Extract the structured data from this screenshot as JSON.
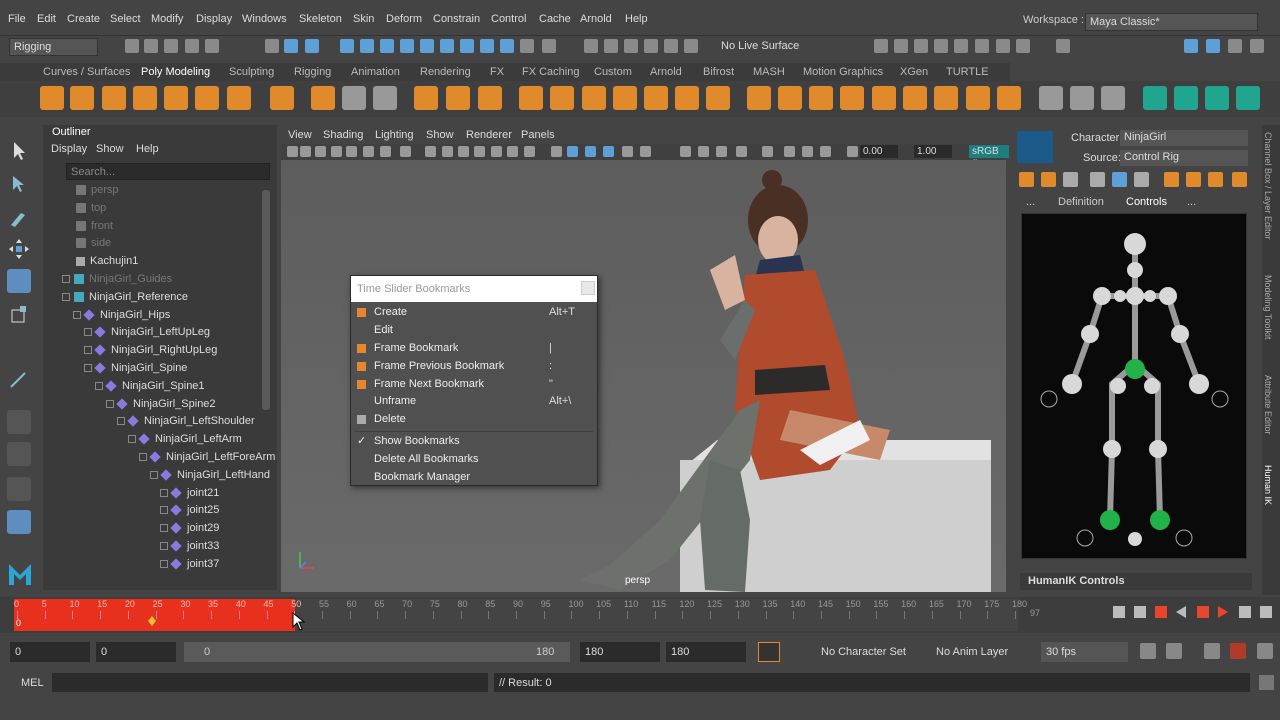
{
  "menubar": {
    "items": [
      "File",
      "Edit",
      "Create",
      "Select",
      "Modify",
      "Display",
      "Windows",
      "Skeleton",
      "Skin",
      "Deform",
      "Constrain",
      "Control",
      "Cache",
      "Arnold",
      "Help"
    ],
    "workspace_label": "Workspace :",
    "workspace_value": "Maya Classic*"
  },
  "statusline": {
    "menuset": "Rigging",
    "live_surface": "No Live Surface"
  },
  "shelf": {
    "tabs": [
      "Curves / Surfaces",
      "Poly Modeling",
      "Sculpting",
      "Rigging",
      "Animation",
      "Rendering",
      "FX",
      "FX Caching",
      "Custom",
      "Arnold",
      "Bifrost",
      "MASH",
      "Motion Graphics",
      "XGen",
      "TURTLE"
    ],
    "active_tab": "Poly Modeling"
  },
  "outliner": {
    "title": "Outliner",
    "menu": [
      "Display",
      "Show",
      "Help"
    ],
    "search_placeholder": "Search...",
    "rows": [
      {
        "label": "persp",
        "dim": true
      },
      {
        "label": "top",
        "dim": true
      },
      {
        "label": "front",
        "dim": true
      },
      {
        "label": "side",
        "dim": true
      },
      {
        "label": "Kachujin1",
        "dim": false
      },
      {
        "label": "NinjaGirl_Guides",
        "dim": true
      },
      {
        "label": "NinjaGirl_Reference",
        "dim": false
      },
      {
        "label": "NinjaGirl_Hips",
        "dim": false
      },
      {
        "label": "NinjaGirl_LeftUpLeg",
        "dim": false
      },
      {
        "label": "NinjaGirl_RightUpLeg",
        "dim": false
      },
      {
        "label": "NinjaGirl_Spine",
        "dim": false
      },
      {
        "label": "NinjaGirl_Spine1",
        "dim": false
      },
      {
        "label": "NinjaGirl_Spine2",
        "dim": false
      },
      {
        "label": "NinjaGirl_LeftShoulder",
        "dim": false
      },
      {
        "label": "NinjaGirl_LeftArm",
        "dim": false
      },
      {
        "label": "NinjaGirl_LeftForeArm",
        "dim": false
      },
      {
        "label": "NinjaGirl_LeftHand",
        "dim": false
      },
      {
        "label": "joint21",
        "dim": false
      },
      {
        "label": "joint25",
        "dim": false
      },
      {
        "label": "joint29",
        "dim": false
      },
      {
        "label": "joint33",
        "dim": false
      },
      {
        "label": "joint37",
        "dim": false
      }
    ]
  },
  "viewport": {
    "menu": [
      "View",
      "Shading",
      "Lighting",
      "Show",
      "Renderer",
      "Panels"
    ],
    "value1": "0.00",
    "value2": "1.00",
    "colorspace": "sRGB g",
    "camera_label": "persp"
  },
  "context_menu": {
    "title": "Time Slider Bookmarks",
    "items": [
      {
        "label": "Create",
        "shortcut": "Alt+T"
      },
      {
        "label": "Edit",
        "shortcut": ""
      },
      {
        "label": "Frame Bookmark",
        "shortcut": "|"
      },
      {
        "label": "Frame Previous Bookmark",
        "shortcut": ":"
      },
      {
        "label": "Frame Next Bookmark",
        "shortcut": "\""
      },
      {
        "label": "Unframe",
        "shortcut": "Alt+\\"
      },
      {
        "label": "Delete",
        "shortcut": ""
      },
      {
        "label": "Show Bookmarks",
        "shortcut": ""
      },
      {
        "label": "Delete All Bookmarks",
        "shortcut": ""
      },
      {
        "label": "Bookmark Manager",
        "shortcut": ""
      }
    ]
  },
  "humanik": {
    "character_label": "Character:",
    "character_value": "NinjaGirl",
    "source_label": "Source:",
    "source_value": "Control Rig",
    "tabs": [
      "...",
      "Definition",
      "Controls",
      "..."
    ],
    "active_tab": "Controls",
    "controls_header": "HumanIK Controls"
  },
  "side_tabs": [
    "Channel Box / Layer Editor",
    "Modeling Toolkit",
    "Attribute Editor",
    "Human IK"
  ],
  "timeline": {
    "ticks": [
      "0",
      "5",
      "10",
      "15",
      "20",
      "25",
      "30",
      "35",
      "40",
      "45",
      "50",
      "55",
      "60",
      "65",
      "70",
      "75",
      "80",
      "85",
      "90",
      "95",
      "100",
      "105",
      "110",
      "115",
      "120",
      "125",
      "130",
      "135",
      "140",
      "145",
      "150",
      "155",
      "160",
      "165",
      "170",
      "175",
      "180"
    ],
    "current_frame": "0",
    "end_field": "97",
    "red_color": "#e8311c"
  },
  "range": {
    "start": "0",
    "anim_start": "0",
    "slider_start": "0",
    "slider_end": "180",
    "anim_end": "180",
    "end": "180",
    "character_set": "No Character Set",
    "anim_layer": "No Anim Layer",
    "fps": "30 fps"
  },
  "cmdline": {
    "lang": "MEL",
    "result": "// Result: 0"
  }
}
